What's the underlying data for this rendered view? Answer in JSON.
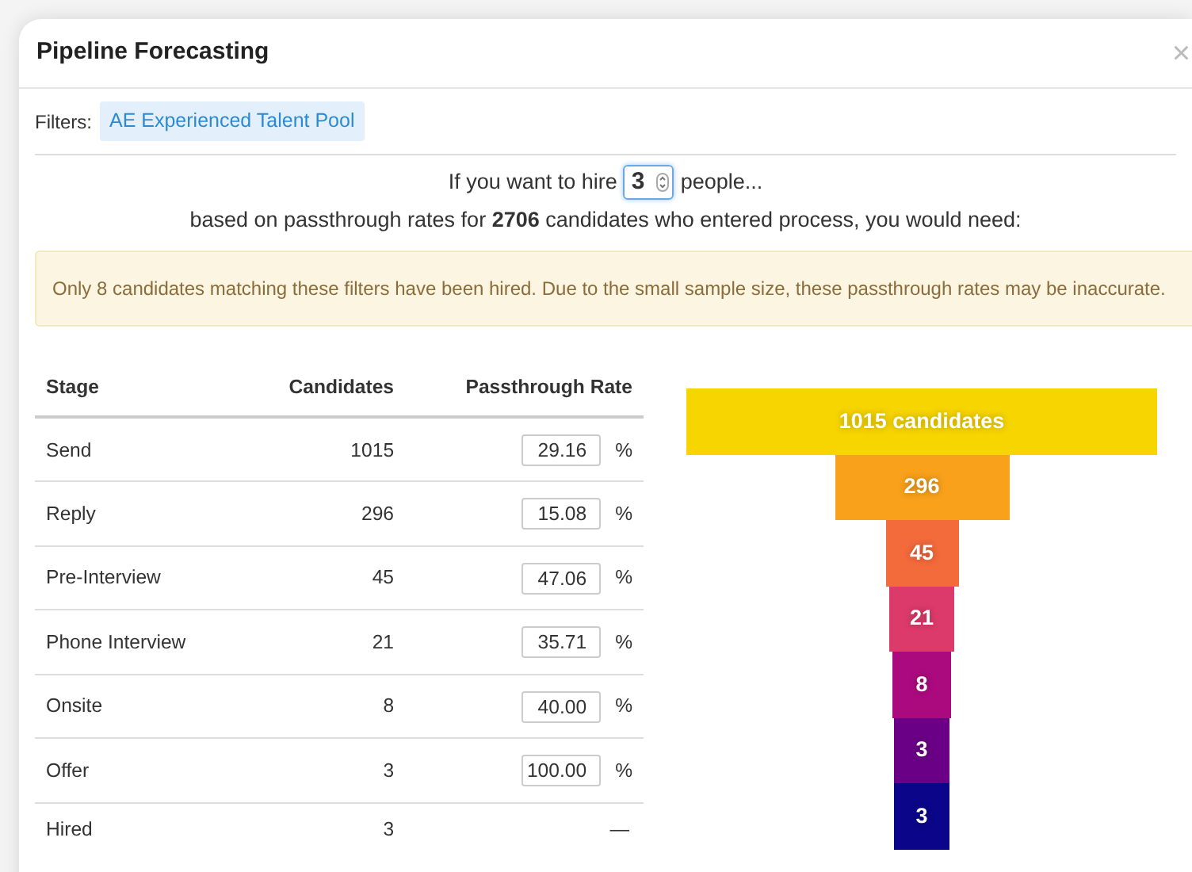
{
  "dialog": {
    "title": "Pipeline Forecasting",
    "close": "×"
  },
  "filters": {
    "label": "Filters:",
    "tags": [
      "AE Experienced Talent Pool"
    ]
  },
  "hire": {
    "prefix": "If you want to hire",
    "value": "3",
    "suffix": "people...",
    "summary": "based on passthrough rates for **2706** candidates who entered process, you would need:"
  },
  "warning": "Only 8 candidates matching these filters have been hired. Due to the small sample size, these passthrough rates may be inaccurate.",
  "table": {
    "columns": [
      "Stage",
      "Candidates",
      "Passthrough Rate"
    ],
    "rows": [
      {
        "stage": "Send",
        "candidates": "1015",
        "rate": "29.16",
        "unit": "%"
      },
      {
        "stage": "Reply",
        "candidates": "296",
        "rate": "15.08",
        "unit": "%"
      },
      {
        "stage": "Pre-Interview",
        "candidates": "45",
        "rate": "47.06",
        "unit": "%"
      },
      {
        "stage": "Phone Interview",
        "candidates": "21",
        "rate": "35.71",
        "unit": "%"
      },
      {
        "stage": "Onsite",
        "candidates": "8",
        "rate": "40.00",
        "unit": "%"
      },
      {
        "stage": "Offer",
        "candidates": "3",
        "rate": "100.00",
        "unit": "%"
      },
      {
        "stage": "Hired",
        "candidates": "3",
        "rate_placeholder": "—"
      }
    ]
  },
  "funnel": [
    {
      "label": "1015 candidates",
      "color": "#f7d500"
    },
    {
      "label": "296",
      "color": "#f9a11b"
    },
    {
      "label": "45",
      "color": "#f36a3b"
    },
    {
      "label": "21",
      "color": "#dc3a6a"
    },
    {
      "label": "8",
      "color": "#ab0a7e"
    },
    {
      "label": "3",
      "color": "#6a0085"
    },
    {
      "label": "3",
      "color": "#0b0689"
    }
  ]
}
